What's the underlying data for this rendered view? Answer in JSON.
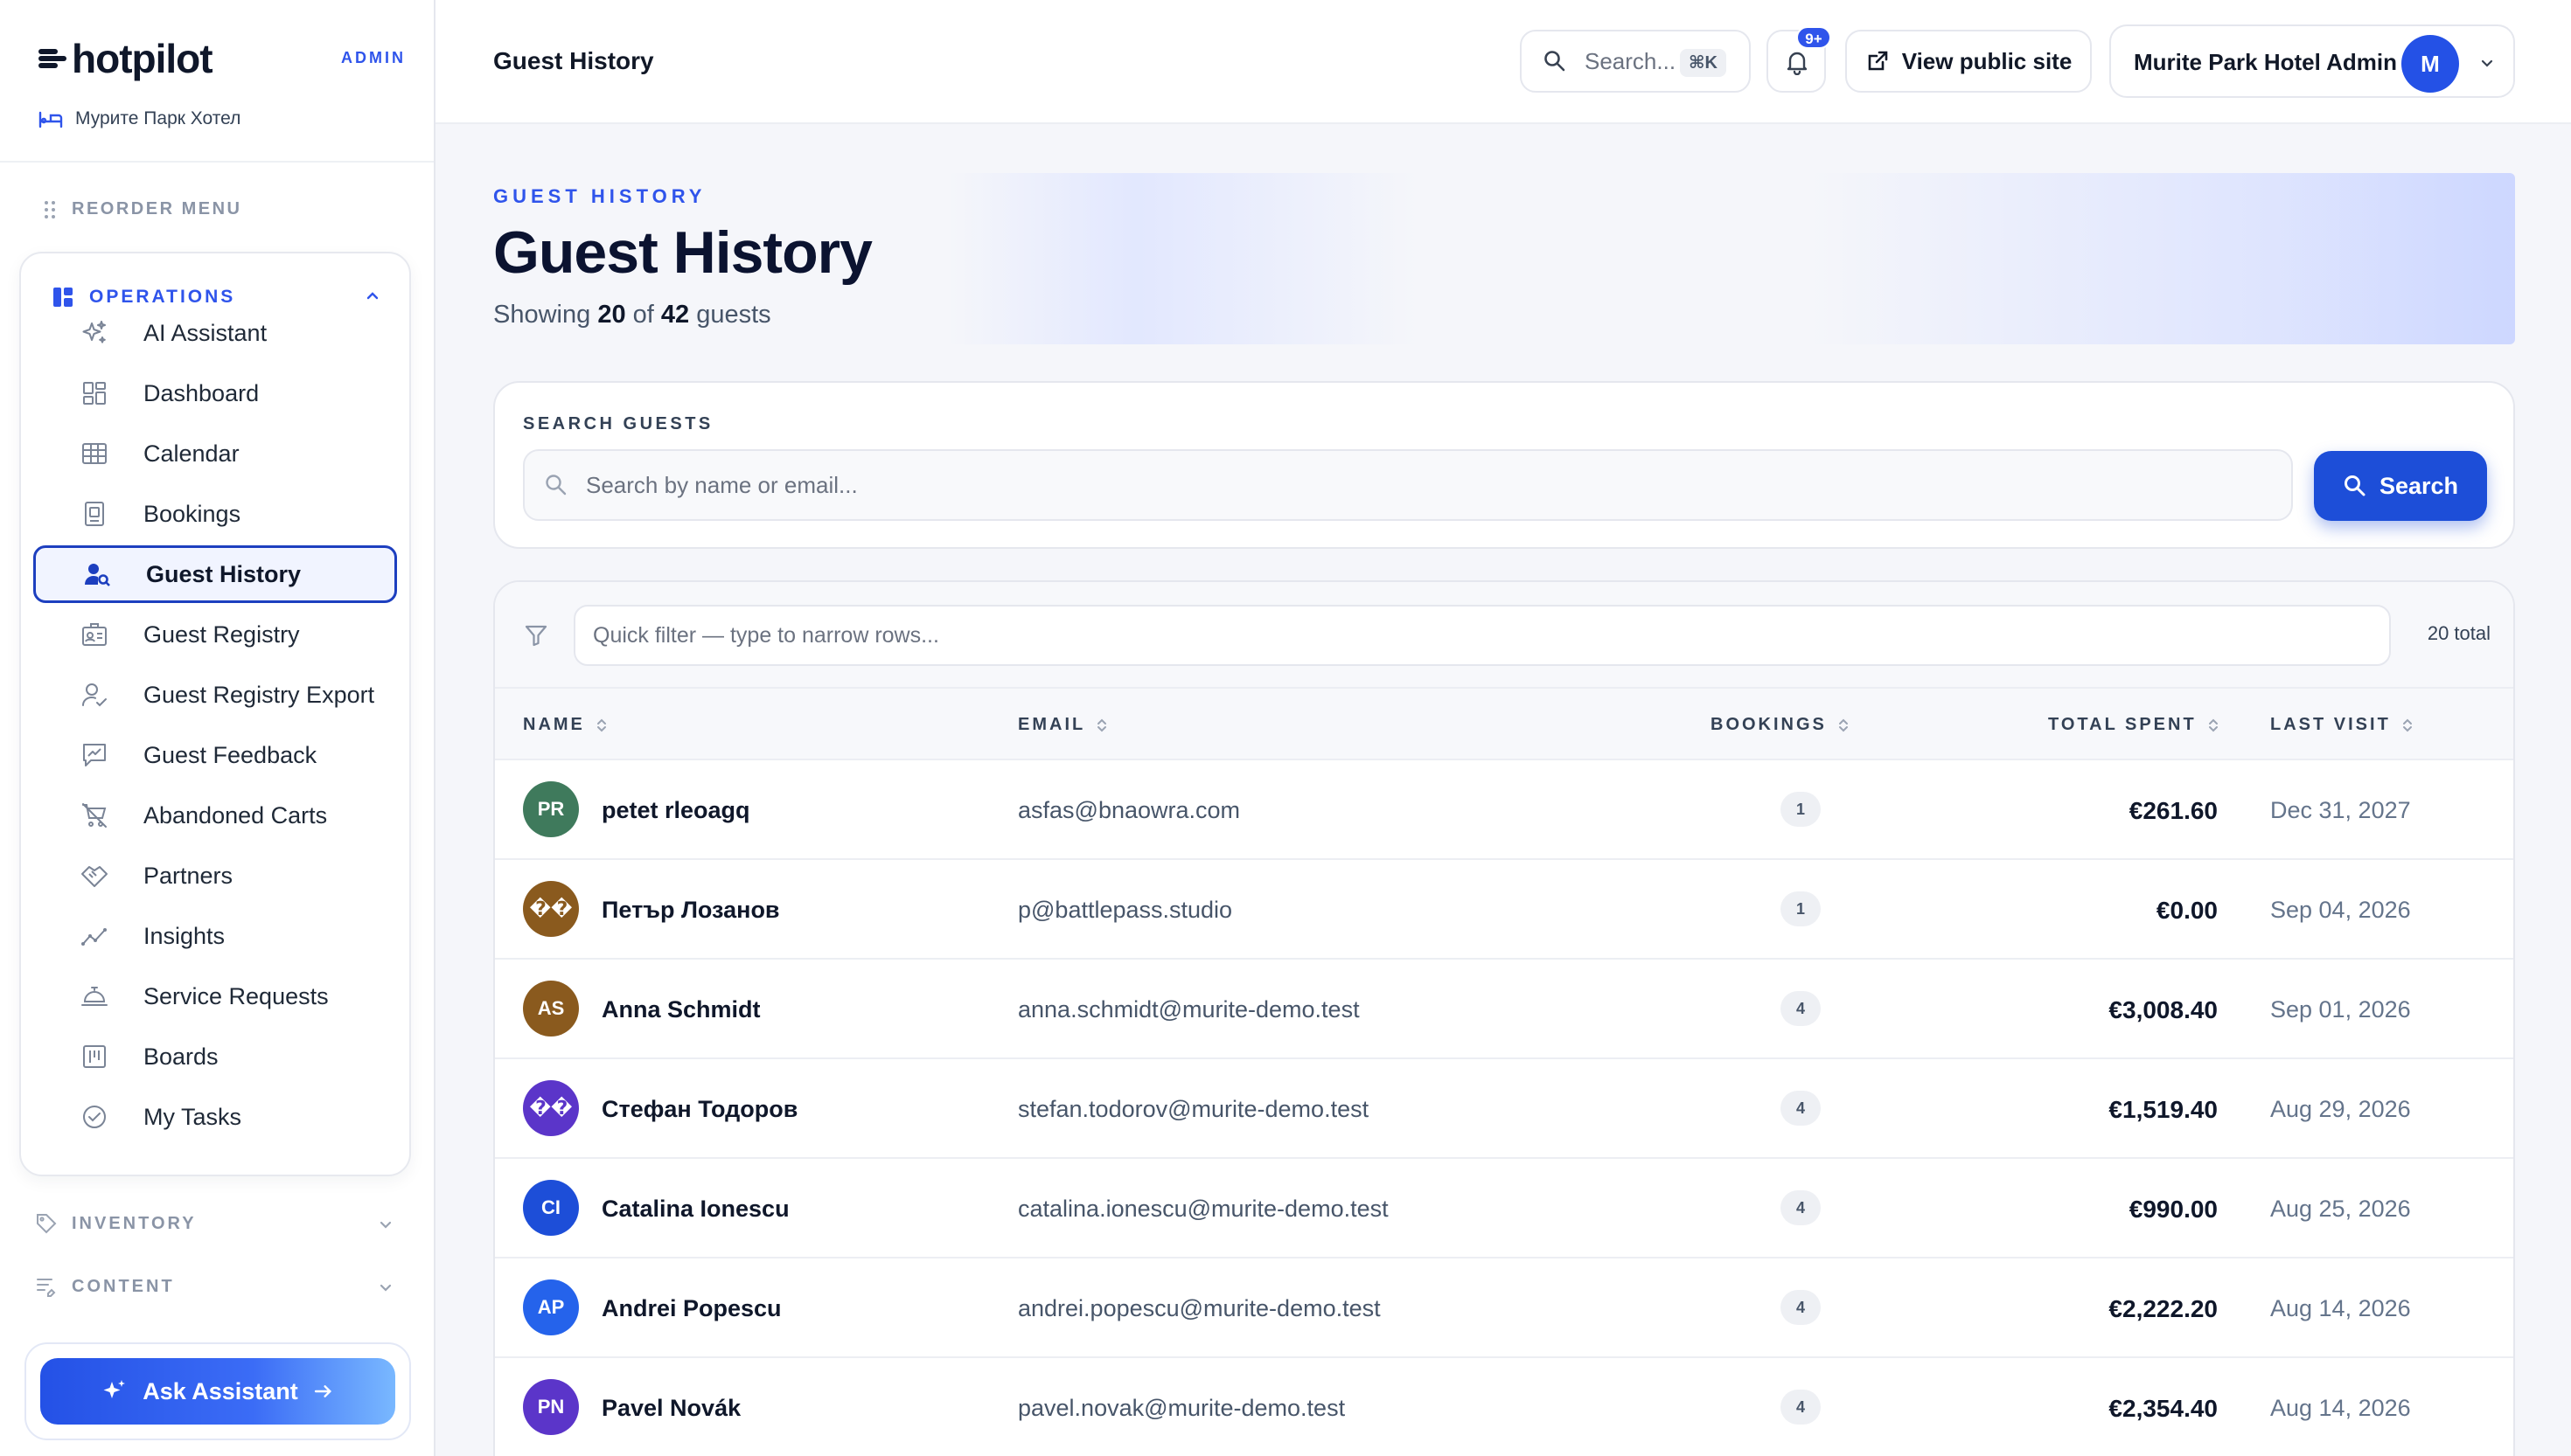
{
  "brand": {
    "name": "hotpilot",
    "badge": "ADMIN",
    "hotel": "Мурите Парк Хотел"
  },
  "sidebar": {
    "reorder_label": "REORDER MENU",
    "operations_title": "OPERATIONS",
    "items": [
      {
        "label": "AI Assistant",
        "icon": "sparkles-icon"
      },
      {
        "label": "Dashboard",
        "icon": "dashboard-icon"
      },
      {
        "label": "Calendar",
        "icon": "calendar-grid-icon"
      },
      {
        "label": "Bookings",
        "icon": "bookings-icon"
      },
      {
        "label": "Guest History",
        "icon": "guest-search-icon",
        "active": true
      },
      {
        "label": "Guest Registry",
        "icon": "registry-icon"
      },
      {
        "label": "Guest Registry Export",
        "icon": "user-check-icon"
      },
      {
        "label": "Guest Feedback",
        "icon": "feedback-icon"
      },
      {
        "label": "Abandoned Carts",
        "icon": "cart-off-icon"
      },
      {
        "label": "Partners",
        "icon": "handshake-icon"
      },
      {
        "label": "Insights",
        "icon": "trend-icon"
      },
      {
        "label": "Service Requests",
        "icon": "service-bell-icon"
      },
      {
        "label": "Boards",
        "icon": "board-icon"
      },
      {
        "label": "My Tasks",
        "icon": "check-circle-icon"
      }
    ],
    "inventory_title": "INVENTORY",
    "content_title": "CONTENT",
    "ask_label": "Ask Assistant"
  },
  "header": {
    "crumb": "Guest History",
    "search_placeholder": "Search...",
    "shortcut": "⌘K",
    "notif_badge": "9+",
    "public_site": "View public site",
    "account": "Murite Park Hotel Admin",
    "avatar_initial": "M"
  },
  "hero": {
    "eyebrow": "GUEST HISTORY",
    "title": "Guest History",
    "sub_prefix": "Showing",
    "shown": "20",
    "sub_mid": "of",
    "total": "42",
    "sub_suffix": "guests"
  },
  "search_card": {
    "label": "SEARCH GUESTS",
    "placeholder": "Search by name or email...",
    "button": "Search"
  },
  "table": {
    "quick_filter_placeholder": "Quick filter — type to narrow rows...",
    "total_label": "20 total",
    "columns": {
      "name": "NAME",
      "email": "EMAIL",
      "bookings": "BOOKINGS",
      "total_spent": "TOTAL SPENT",
      "last_visit": "LAST VISIT"
    },
    "rows": [
      {
        "initials": "PR",
        "color": "#3f7a5c",
        "name": "petet rleoagq",
        "email": "asfas@bnaowra.com",
        "bookings": "1",
        "total_spent": "€261.60",
        "last_visit": "Dec 31, 2027"
      },
      {
        "initials": "��",
        "color": "#8a5a1e",
        "name": "Петър Лозанов",
        "email": "p@battlepass.studio",
        "bookings": "1",
        "total_spent": "€0.00",
        "last_visit": "Sep 04, 2026"
      },
      {
        "initials": "AS",
        "color": "#8a5a1e",
        "name": "Anna Schmidt",
        "email": "anna.schmidt@murite-demo.test",
        "bookings": "4",
        "total_spent": "€3,008.40",
        "last_visit": "Sep 01, 2026"
      },
      {
        "initials": "��",
        "color": "#5b35c9",
        "name": "Стефан Тодоров",
        "email": "stefan.todorov@murite-demo.test",
        "bookings": "4",
        "total_spent": "€1,519.40",
        "last_visit": "Aug 29, 2026"
      },
      {
        "initials": "CI",
        "color": "#1d4ed8",
        "name": "Catalina Ionescu",
        "email": "catalina.ionescu@murite-demo.test",
        "bookings": "4",
        "total_spent": "€990.00",
        "last_visit": "Aug 25, 2026"
      },
      {
        "initials": "AP",
        "color": "#2563eb",
        "name": "Andrei Popescu",
        "email": "andrei.popescu@murite-demo.test",
        "bookings": "4",
        "total_spent": "€2,222.20",
        "last_visit": "Aug 14, 2026"
      },
      {
        "initials": "PN",
        "color": "#5b35c9",
        "name": "Pavel Novák",
        "email": "pavel.novak@murite-demo.test",
        "bookings": "4",
        "total_spent": "€2,354.40",
        "last_visit": "Aug 14, 2026"
      }
    ]
  }
}
